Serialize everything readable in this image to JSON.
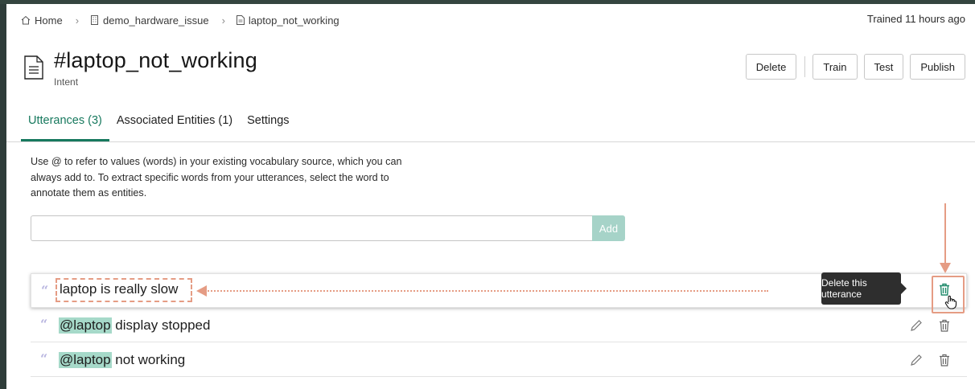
{
  "breadcrumb": {
    "home": "Home",
    "workspace": "demo_hardware_issue",
    "intent": "laptop_not_working"
  },
  "status": {
    "trained": "Trained 11 hours ago"
  },
  "header": {
    "title": "#laptop_not_working",
    "subtitle": "Intent"
  },
  "actions": {
    "delete": "Delete",
    "train": "Train",
    "test": "Test",
    "publish": "Publish"
  },
  "tabs": [
    {
      "label": "Utterances (3)",
      "active": true
    },
    {
      "label": "Associated Entities (1)",
      "active": false
    },
    {
      "label": "Settings",
      "active": false
    }
  ],
  "helper_text": "Use @ to refer to values (words) in your existing vocabulary source, which you can always add to. To extract specific words from your utterances, select the word to annotate them as entities.",
  "utterance_input": {
    "value": "",
    "placeholder": "",
    "add_label": "Add"
  },
  "utterances": [
    {
      "entity": "",
      "text": "laptop is really slow"
    },
    {
      "entity": "@laptop",
      "text": " display stopped"
    },
    {
      "entity": "@laptop",
      "text": " not working"
    }
  ],
  "tooltip": "Delete this utterance",
  "colors": {
    "accent": "#17795e",
    "entity_highlight": "#a6d9c9",
    "add_button": "#a6d3c8",
    "annotation": "#e59c84"
  }
}
